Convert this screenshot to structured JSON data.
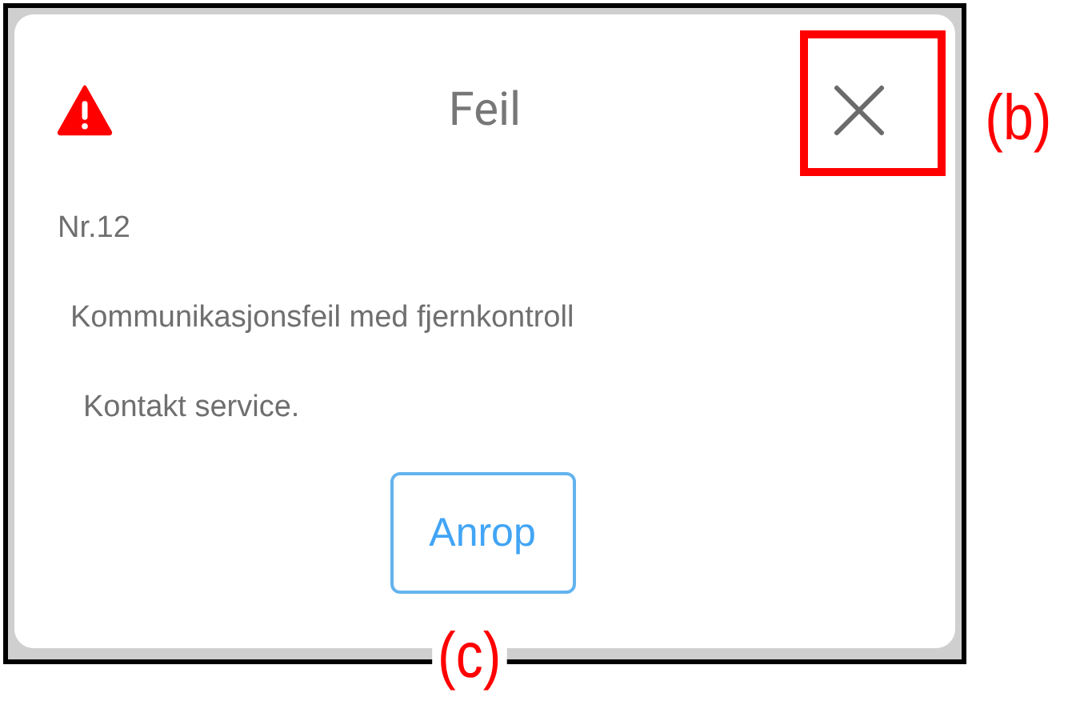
{
  "dialog": {
    "title": "Feil",
    "lines": [
      "Nr.12",
      "Kommunikasjonsfeil med fjernkontroll",
      "Kontakt service."
    ],
    "button": "Anrop"
  },
  "annotations": [
    {
      "label": "(b)",
      "kind": "boxed"
    },
    {
      "label": "(c)",
      "kind": "plain"
    }
  ]
}
